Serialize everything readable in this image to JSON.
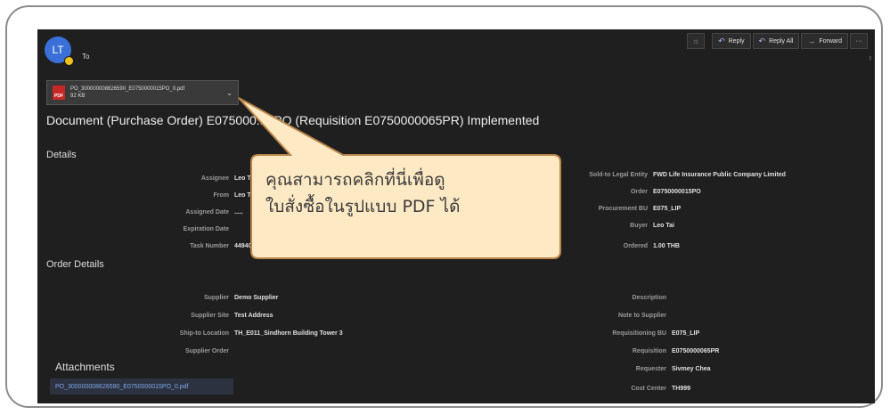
{
  "header": {
    "avatar_initials": "LT",
    "to_label": "To",
    "toolbar": {
      "reply_label": "Reply",
      "reply_all_label": "Reply All",
      "forward_label": "Forward",
      "more_label": "···"
    },
    "right_marker": "!"
  },
  "attachment_chip": {
    "file_name": "PO_300000008626590_E0750000015PO_0.pdf",
    "file_size": "92 KB",
    "icon_label": "PDF"
  },
  "document_title": "Document (Purchase Order) E075000...5PO (Requisition E0750000065PR) Implemented",
  "details": {
    "section_title": "Details",
    "left": [
      {
        "label": "Assignee",
        "value": "Leo Ta"
      },
      {
        "label": "From",
        "value": "Leo Ta"
      },
      {
        "label": "Assigned Date",
        "value": "....."
      },
      {
        "label": "Expiration Date",
        "value": ""
      },
      {
        "label": "Task Number",
        "value": "449403"
      }
    ],
    "right": [
      {
        "label": "Sold-to Legal Entity",
        "value": "FWD Life Insurance Public Company Limited"
      },
      {
        "label": "Order",
        "value": "E0750000015PO"
      },
      {
        "label": "Procurement BU",
        "value": "E075_LIP"
      },
      {
        "label": "Buyer",
        "value": "Leo Tai"
      },
      {
        "label": "Ordered",
        "value": "1.00 THB"
      }
    ]
  },
  "order_details": {
    "section_title": "Order Details",
    "left": [
      {
        "label": "Supplier",
        "value": "Demo Supplier"
      },
      {
        "label": "Supplier Site",
        "value": "Test Address"
      },
      {
        "label": "Ship-to Location",
        "value": "TH_E011_Sindhorn Building Tower 3"
      },
      {
        "label": "Supplier Order",
        "value": ""
      }
    ],
    "right": [
      {
        "label": "Description",
        "value": ""
      },
      {
        "label": "Note to Supplier",
        "value": ""
      },
      {
        "label": "Requisitioning BU",
        "value": "E075_LIP"
      },
      {
        "label": "Requisition",
        "value": "E0750000065PR"
      },
      {
        "label": "Requester",
        "value": "Sivmey Chea"
      },
      {
        "label": "Cost Center",
        "value": "TH999"
      }
    ]
  },
  "attachments": {
    "section_title": "Attachments",
    "link_label": "PO_300000008626590_E0750000015PO_0.pdf"
  },
  "callout": {
    "line1": "คุณสามารถคลิกที่นี่เพื่อดู",
    "line2": "ใบสั่งซื้อในรูปแบบ PDF ได้",
    "fill_color": "#fde9c4",
    "border_color": "#b8864a"
  }
}
